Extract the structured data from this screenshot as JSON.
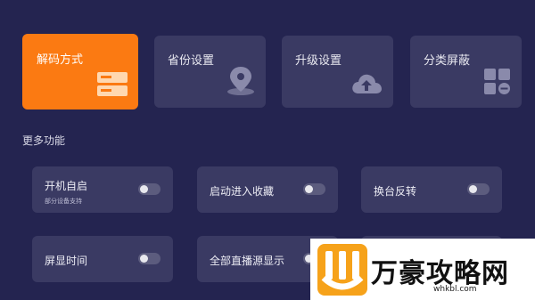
{
  "top_cards": [
    {
      "label": "解码方式",
      "icon": "server-icon",
      "active": true
    },
    {
      "label": "省份设置",
      "icon": "location-pin-icon",
      "active": false
    },
    {
      "label": "升级设置",
      "icon": "cloud-upload-icon",
      "active": false
    },
    {
      "label": "分类屏蔽",
      "icon": "grid-block-icon",
      "active": false
    }
  ],
  "more_section": {
    "title": "更多功能",
    "items": [
      {
        "label": "开机自启",
        "sub": "部分设备支持",
        "on": false
      },
      {
        "label": "启动进入收藏",
        "on": false
      },
      {
        "label": "换台反转",
        "on": false
      },
      {
        "label": "屏显时间",
        "on": false
      },
      {
        "label": "全部直播源显示",
        "on": false
      }
    ]
  },
  "watermark": {
    "text": "万豪攻略网",
    "url": "whkbl.com"
  },
  "colors": {
    "background": "#242450",
    "card": "#3a3a63",
    "accent": "#fb7a12"
  }
}
